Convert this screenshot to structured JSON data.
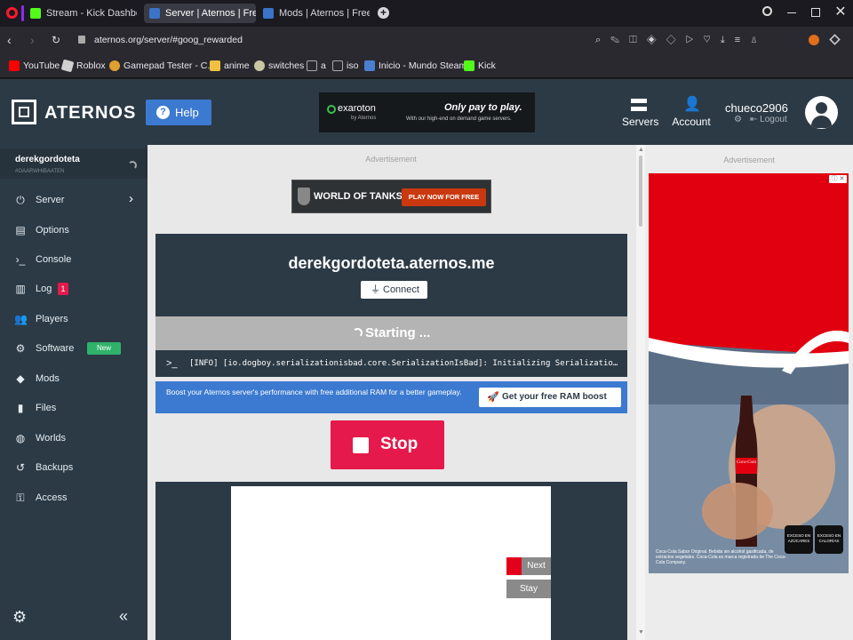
{
  "browser": {
    "tabs": [
      {
        "label": "Stream - Kick Dashbo",
        "active": false,
        "color": "#53fc18"
      },
      {
        "label": "Server | Aternos | Free Mi",
        "active": true,
        "color": "#3b73c8"
      },
      {
        "label": "Mods | Aternos | Free Mi",
        "active": false,
        "color": "#3b73c8"
      }
    ],
    "url": "aternos.org/server/#goog_rewarded",
    "bookmarks": [
      {
        "label": "YouTube",
        "color": "#ff0000"
      },
      {
        "label": "Roblox",
        "color": "#d0d0d0"
      },
      {
        "label": "Gamepad Tester - C...",
        "color": "#e0a030"
      },
      {
        "label": "anime",
        "color": "#f0c040"
      },
      {
        "label": "switches",
        "color": "#c8c8a0"
      },
      {
        "label": "a",
        "color": "#aaaaaa"
      },
      {
        "label": "iso",
        "color": "#aaaaaa"
      },
      {
        "label": "Inicio - Mundo Steam",
        "color": "#4a7fd0"
      },
      {
        "label": "Kick",
        "color": "#53fc18"
      }
    ]
  },
  "header": {
    "logo": "ATERNOS",
    "help": "Help",
    "ad_brand": "exaroton",
    "ad_brand_sub": "by Aternos",
    "ad_title": "Only pay to play.",
    "ad_sub": "With our high-end on demand game servers.",
    "servers": "Servers",
    "account": "Account",
    "username": "chueco2906",
    "logout": "Logout"
  },
  "sidebar": {
    "server_name": "derekgordoteta",
    "server_sub": "#OAARWHIBAATEN",
    "items": [
      {
        "label": "Server",
        "icon": "power-icon",
        "glyph": "⏻"
      },
      {
        "label": "Options",
        "icon": "options-icon",
        "glyph": "▤"
      },
      {
        "label": "Console",
        "icon": "console-icon",
        "glyph": "›_"
      },
      {
        "label": "Log",
        "icon": "log-icon",
        "glyph": "▥"
      },
      {
        "label": "Players",
        "icon": "players-icon",
        "glyph": "👥"
      },
      {
        "label": "Software",
        "icon": "software-icon",
        "glyph": "⚙"
      },
      {
        "label": "Mods",
        "icon": "mods-icon",
        "glyph": "◆"
      },
      {
        "label": "Files",
        "icon": "files-icon",
        "glyph": "▮"
      },
      {
        "label": "Worlds",
        "icon": "worlds-icon",
        "glyph": "◍"
      },
      {
        "label": "Backups",
        "icon": "backups-icon",
        "glyph": "↺"
      },
      {
        "label": "Access",
        "icon": "access-icon",
        "glyph": "⚿"
      }
    ],
    "log_badge": "1",
    "software_badge": "New"
  },
  "main": {
    "advertisement": "Advertisement",
    "wot_text": "WORLD OF TANKS",
    "wot_cta": "PLAY NOW FOR FREE",
    "address": "derekgordoteta.aternos.me",
    "connect": "Connect",
    "status": "Starting ...",
    "console_line": "[INFO] [io.dogboy.serializationisbad.core.SerializationIsBad]: Initializing Serializatio…",
    "boost_text": "Boost your Aternos server's performance with free additional RAM for a better gameplay.",
    "boost_button": "Get your free RAM boost",
    "stop": "Stop",
    "next": "Next",
    "stay": "Stay"
  },
  "right": {
    "advertisement": "Advertisement",
    "coke_disclaimer": "Coca-Cola Sabor Original. Bebida sin alcohol gasificada, de extractos vegetales. Coca-Cola es marca registrada de The Coca-Cola Company.",
    "seal1": "EXCESO EN AZÚCARES",
    "seal2": "EXCESO EN CALORÍAS",
    "brand": "Coca-Cola"
  }
}
